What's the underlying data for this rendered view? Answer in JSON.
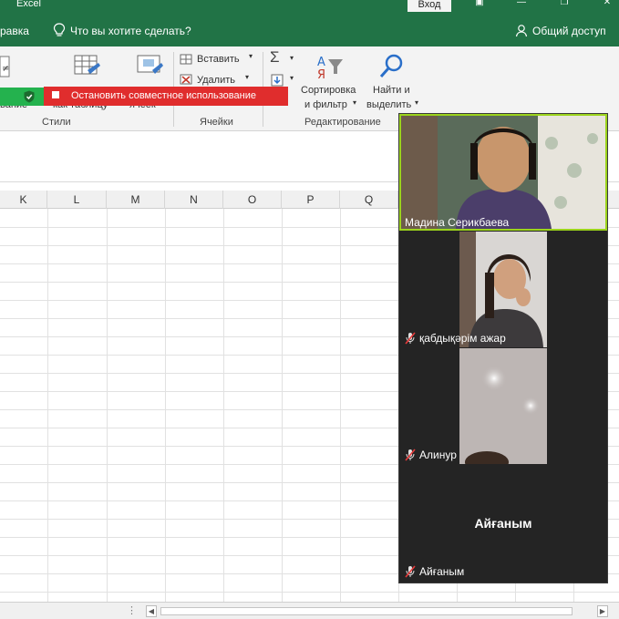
{
  "titlebar": {
    "app_title": "Excel",
    "login_label": "Вход"
  },
  "tabs": {
    "help": "равка",
    "tell_me": "Что вы хотите сделать?",
    "share": "Общий доступ"
  },
  "ribbon": {
    "partial_left_1": "вание",
    "partial_left_2": "как таблицу",
    "partial_left_3": "ячеек",
    "insert": "Вставить",
    "delete": "Удалить",
    "sort_line1": "Сортировка",
    "sort_line2": "и фильтр",
    "find_line1": "Найти и",
    "find_line2": "выделить",
    "group_styles": "Стили",
    "group_cells": "Ячейки",
    "group_editing": "Редактирование"
  },
  "sharebar": {
    "stop_label": "Остановить совместное использование"
  },
  "grid": {
    "columns": [
      "K",
      "L",
      "M",
      "N",
      "O",
      "P",
      "Q"
    ]
  },
  "video": {
    "participants": [
      {
        "name": "Мадина Серикбаева",
        "muted": false,
        "active": true
      },
      {
        "name": "қабдықәрім ажар",
        "muted": true
      },
      {
        "name": "Алинур",
        "muted": true
      },
      {
        "name": "Айғаным",
        "muted": true,
        "placeholder": "Айғаным"
      }
    ]
  },
  "colors": {
    "excel_green": "#217346",
    "share_red": "#e02d2d",
    "share_green": "#24b24e",
    "active_speaker": "#9bd31b"
  }
}
